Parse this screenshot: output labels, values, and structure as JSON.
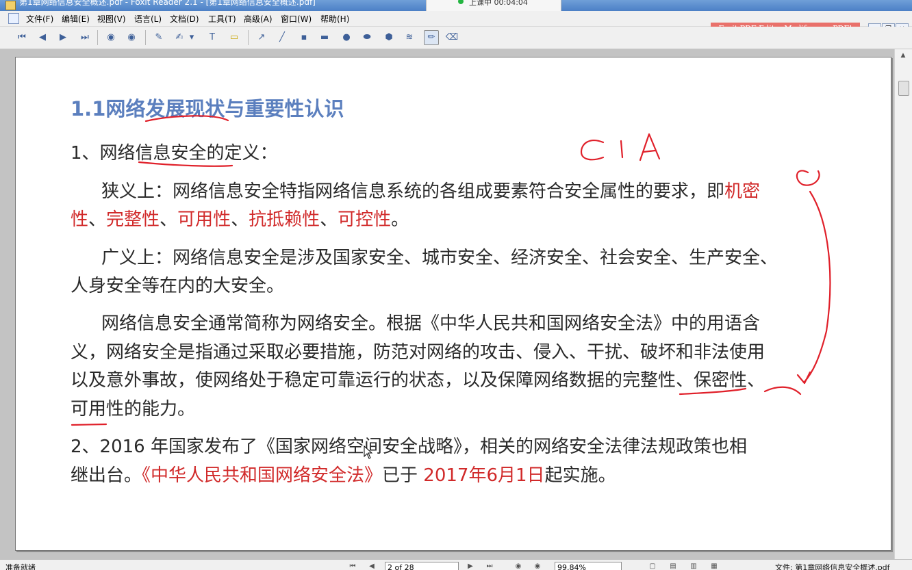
{
  "window": {
    "title": "第1章网络信息安全概述.pdf - Foxit Reader 2.1 - [第1章网络信息安全概述.pdf]",
    "overlay_status": "上课中 00:04:04",
    "promo": "Foxit PDF Editor,Modify your PDF!"
  },
  "menu": [
    "文件(F)",
    "编辑(E)",
    "视图(V)",
    "语言(L)",
    "文档(D)",
    "工具(T)",
    "高级(A)",
    "窗口(W)",
    "帮助(H)"
  ],
  "page": {
    "heading": "1.1网络发展现状与重要性认识",
    "item1": "1、网络信息安全的定义：",
    "narrow_line1_prefix": "狭义上：网络信息安全特指网络信息系统的各组成要素符合安全属性的要求，即",
    "narrow_line1_red": "机密",
    "narrow_line2_parts": [
      "性",
      "、",
      "完整性",
      "、",
      "可用性",
      "、",
      "抗抵赖性",
      "、",
      "可控性",
      "。"
    ],
    "broad_line1": "广义上：网络信息安全是涉及国家安全、城市安全、经济安全、社会安全、生产安全、",
    "broad_line2": "人身安全等在内的大安全。",
    "law_line1": "网络信息安全通常简称为网络安全。根据《中华人民共和国网络安全法》中的用语含",
    "law_line2": "义，网络安全是指通过采取必要措施，防范对网络的攻击、侵入、干扰、破坏和非法使用",
    "law_line3": "以及意外事故，使网络处于稳定可靠运行的状态，以及保障网络数据的完整性、保密性、",
    "law_line4": "可用性的能力。",
    "item2_line1": "2、2016 年国家发布了《国家网络空间安全战略》，相关的网络安全法律法规政策也相",
    "item2_line2_a": "继出台。",
    "item2_line2_red1": "《中华人民共和国网络安全法》",
    "item2_line2_b": "已于 ",
    "item2_line2_red2": "2017年6月1日",
    "item2_line2_c": "起实施。",
    "annotation_cia": "CIA"
  },
  "status": {
    "left": "准备就绪",
    "page_box": "2 of 28",
    "zoom": "99.84%",
    "file": "文件: 第1章网络信息安全概述.pdf"
  },
  "colors": {
    "heading": "#5b7fbe",
    "accent_red": "#d12a2a",
    "ink": "#e0202a"
  }
}
